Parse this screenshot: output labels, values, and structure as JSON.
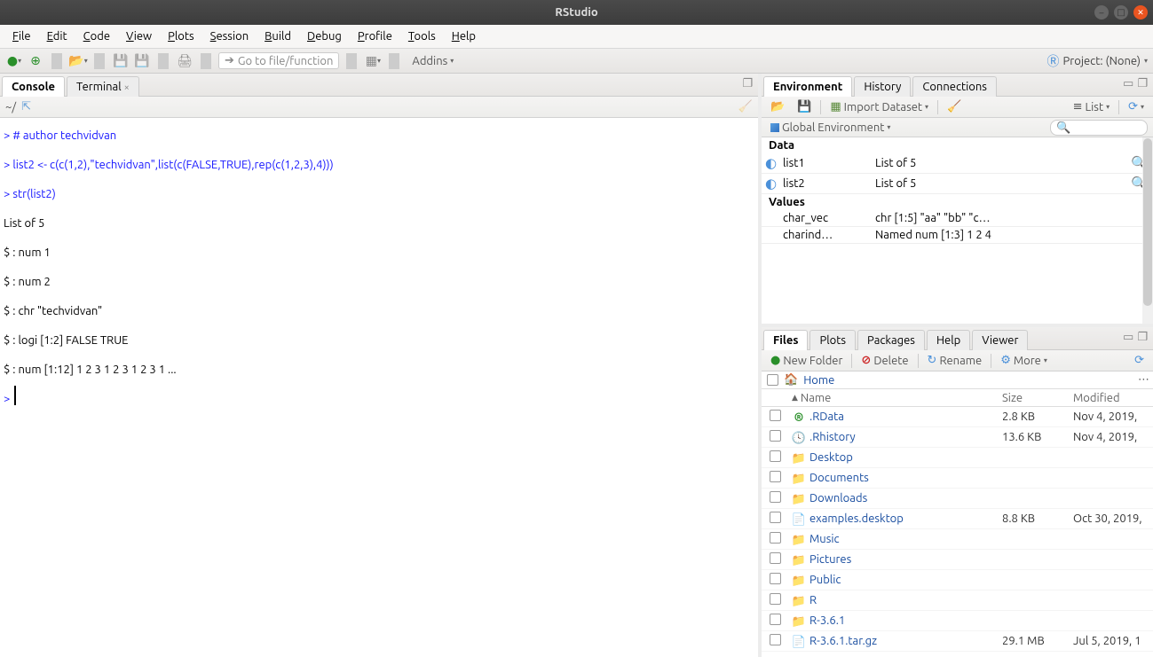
{
  "window": {
    "title": "RStudio"
  },
  "menus": [
    "File",
    "Edit",
    "Code",
    "View",
    "Plots",
    "Session",
    "Build",
    "Debug",
    "Profile",
    "Tools",
    "Help"
  ],
  "toolbar": {
    "goto_placeholder": "Go to file/function",
    "addins_label": "Addins",
    "project_label": "Project: (None)"
  },
  "left_tabs": {
    "console": "Console",
    "terminal": "Terminal"
  },
  "console": {
    "path": "~/",
    "lines": [
      {
        "t": "prompt",
        "text": "> "
      },
      {
        "t": "cmd",
        "text": "# author techvidvan"
      },
      {
        "t": "nl"
      },
      {
        "t": "prompt",
        "text": "> "
      },
      {
        "t": "cmd",
        "text": "list2 <- c(c(1,2),\"techvidvan\",list(c(FALSE,TRUE),rep(c(1,2,3),4)))"
      },
      {
        "t": "nl"
      },
      {
        "t": "prompt",
        "text": "> "
      },
      {
        "t": "cmd",
        "text": "str(list2)"
      },
      {
        "t": "nl"
      },
      {
        "t": "out",
        "text": "List of 5"
      },
      {
        "t": "nl"
      },
      {
        "t": "out",
        "text": " $ : num 1"
      },
      {
        "t": "nl"
      },
      {
        "t": "out",
        "text": " $ : num 2"
      },
      {
        "t": "nl"
      },
      {
        "t": "out",
        "text": " $ : chr \"techvidvan\""
      },
      {
        "t": "nl"
      },
      {
        "t": "out",
        "text": " $ : logi [1:2] FALSE TRUE"
      },
      {
        "t": "nl"
      },
      {
        "t": "out",
        "text": " $ : num [1:12] 1 2 3 1 2 3 1 2 3 1 ..."
      },
      {
        "t": "nl"
      },
      {
        "t": "prompt",
        "text": "> "
      },
      {
        "t": "cursor"
      }
    ]
  },
  "env_tabs": {
    "env": "Environment",
    "hist": "History",
    "conn": "Connections"
  },
  "env_toolbar": {
    "import": "Import Dataset",
    "list": "List",
    "global": "Global Environment"
  },
  "env": {
    "data_header": "Data",
    "values_header": "Values",
    "data": [
      {
        "name": "list1",
        "val": "List of 5"
      },
      {
        "name": "list2",
        "val": "List of 5"
      }
    ],
    "values": [
      {
        "name": "char_vec",
        "val": "chr [1:5] \"aa\" \"bb\" \"c…"
      },
      {
        "name": "charind…",
        "val": "Named num [1:3] 1 2 4"
      }
    ]
  },
  "files_tabs": {
    "files": "Files",
    "plots": "Plots",
    "pkg": "Packages",
    "help": "Help",
    "viewer": "Viewer"
  },
  "files_toolbar": {
    "new_folder": "New Folder",
    "delete": "Delete",
    "rename": "Rename",
    "more": "More"
  },
  "files": {
    "home": "Home",
    "cols": {
      "name": "Name",
      "size": "Size",
      "mod": "Modified"
    },
    "rows": [
      {
        "icon": "rdata",
        "name": ".RData",
        "size": "2.8 KB",
        "mod": "Nov 4, 2019,"
      },
      {
        "icon": "hist",
        "name": ".Rhistory",
        "size": "13.6 KB",
        "mod": "Nov 4, 2019,"
      },
      {
        "icon": "folder",
        "name": "Desktop",
        "size": "",
        "mod": ""
      },
      {
        "icon": "folder",
        "name": "Documents",
        "size": "",
        "mod": ""
      },
      {
        "icon": "folder",
        "name": "Downloads",
        "size": "",
        "mod": ""
      },
      {
        "icon": "file",
        "name": "examples.desktop",
        "size": "8.8 KB",
        "mod": "Oct 30, 2019,"
      },
      {
        "icon": "folder",
        "name": "Music",
        "size": "",
        "mod": ""
      },
      {
        "icon": "folder",
        "name": "Pictures",
        "size": "",
        "mod": ""
      },
      {
        "icon": "folder",
        "name": "Public",
        "size": "",
        "mod": ""
      },
      {
        "icon": "folder",
        "name": "R",
        "size": "",
        "mod": ""
      },
      {
        "icon": "folder",
        "name": "R-3.6.1",
        "size": "",
        "mod": ""
      },
      {
        "icon": "file",
        "name": "R-3.6.1.tar.gz",
        "size": "29.1 MB",
        "mod": "Jul 5, 2019, 1"
      }
    ]
  }
}
